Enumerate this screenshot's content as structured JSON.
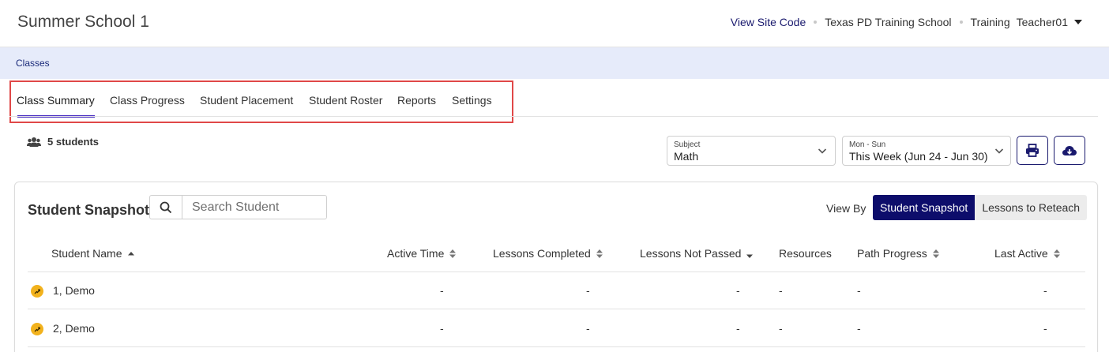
{
  "header": {
    "title": "Summer School 1",
    "view_site_code": "View Site Code",
    "school": "Texas PD Training School",
    "user_first": "Training",
    "user_last": "Teacher01"
  },
  "breadcrumb": "Classes",
  "tabs": [
    {
      "label": "Class Summary",
      "active": true
    },
    {
      "label": "Class Progress",
      "active": false
    },
    {
      "label": "Student Placement",
      "active": false
    },
    {
      "label": "Student Roster",
      "active": false
    },
    {
      "label": "Reports",
      "active": false
    },
    {
      "label": "Settings",
      "active": false
    }
  ],
  "students_count": "5 students",
  "filters": {
    "subject": {
      "label": "Subject",
      "value": "Math"
    },
    "week": {
      "label": "Mon - Sun",
      "value": "This Week (Jun 24 - Jun 30)"
    }
  },
  "snapshot": {
    "title": "Student Snapshot",
    "search_placeholder": "Search Student",
    "view_by_label": "View By",
    "view_options": [
      "Student Snapshot",
      "Lessons to Reteach"
    ],
    "selected_view": "Student Snapshot"
  },
  "table": {
    "columns": [
      "Student Name",
      "Active Time",
      "Lessons Completed",
      "Lessons Not Passed",
      "Resources",
      "Path Progress",
      "Last Active"
    ],
    "rows": [
      {
        "name": "1, Demo",
        "active_time": "-",
        "lessons_completed": "-",
        "lessons_not_passed": "-",
        "resources": "-",
        "path_progress": "-",
        "last_active": "-"
      },
      {
        "name": "2, Demo",
        "active_time": "-",
        "lessons_completed": "-",
        "lessons_not_passed": "-",
        "resources": "-",
        "path_progress": "-",
        "last_active": "-"
      }
    ]
  },
  "icons": {
    "students": "users-icon",
    "print": "print-icon",
    "download": "cloud-download-icon",
    "search": "search-icon",
    "status": "running-icon"
  },
  "colors": {
    "accent": "#0d0d6b",
    "tab_underline": "#4a2fc2",
    "breadcrumb_bg": "#e6ebfa",
    "highlight_border": "#e04848",
    "status_dot": "#f2b21d"
  }
}
